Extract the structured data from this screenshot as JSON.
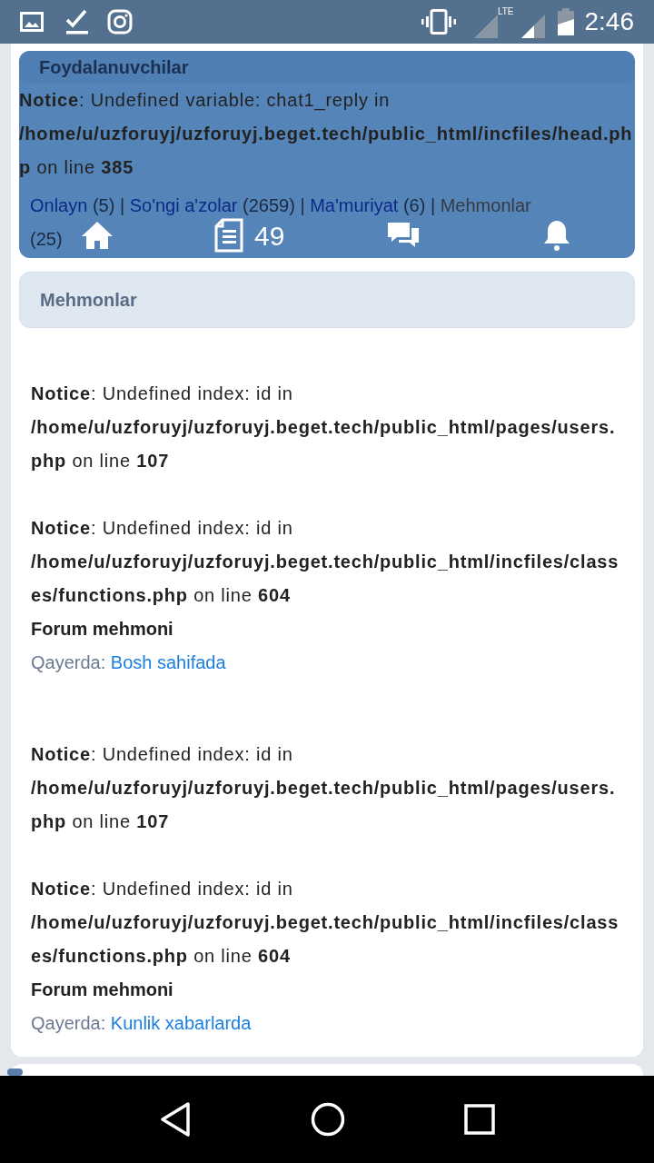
{
  "status_bar": {
    "network_label": "LTE",
    "time": "2:46"
  },
  "navbar": {
    "notice": "**Notice**: Undefined variable: chat1_reply in **/home/u/uzforuyj/uzforuyj.beget.tech/public_html/incfiles/head.php** on line **385**",
    "items": [
      {
        "kind": "home"
      },
      {
        "kind": "document",
        "count": "49"
      },
      {
        "kind": "chat"
      },
      {
        "kind": "bell"
      }
    ]
  },
  "users_section": {
    "title": "Foydalanuvchilar",
    "separator": " | ",
    "links": [
      {
        "label": "Onlayn",
        "count": " (5)",
        "link": true
      },
      {
        "label": "So'ngi a'zolar",
        "count": " (2659)",
        "link": true
      },
      {
        "label": "Ma'muriyat",
        "count": " (6)",
        "link": true
      },
      {
        "label": "Mehmonlar",
        "count": " (25)",
        "link": false
      }
    ]
  },
  "guests_section": {
    "title": "Mehmonlar",
    "entries": [
      {
        "notices": [
          "**Notice**: Undefined index: id in **/home/u/uzforuyj/uzforuyj.beget.tech/public_html/pages/users.php** on line **107**",
          "**Notice**: Undefined index: id in **/home/u/uzforuyj/uzforuyj.beget.tech/public_html/incfiles/classes/functions.php** on line **604**"
        ],
        "name": "Forum mehmoni",
        "location_label": "Qayerda: ",
        "location": "Bosh sahifada"
      },
      {
        "notices": [
          "**Notice**: Undefined index: id in **/home/u/uzforuyj/uzforuyj.beget.tech/public_html/pages/users.php** on line **107**",
          "**Notice**: Undefined index: id in **/home/u/uzforuyj/uzforuyj.beget.tech/public_html/incfiles/classes/functions.php** on line **604**"
        ],
        "name": "Forum mehmoni",
        "location_label": "Qayerda: ",
        "location": "Kunlik xabarlarda"
      }
    ]
  }
}
